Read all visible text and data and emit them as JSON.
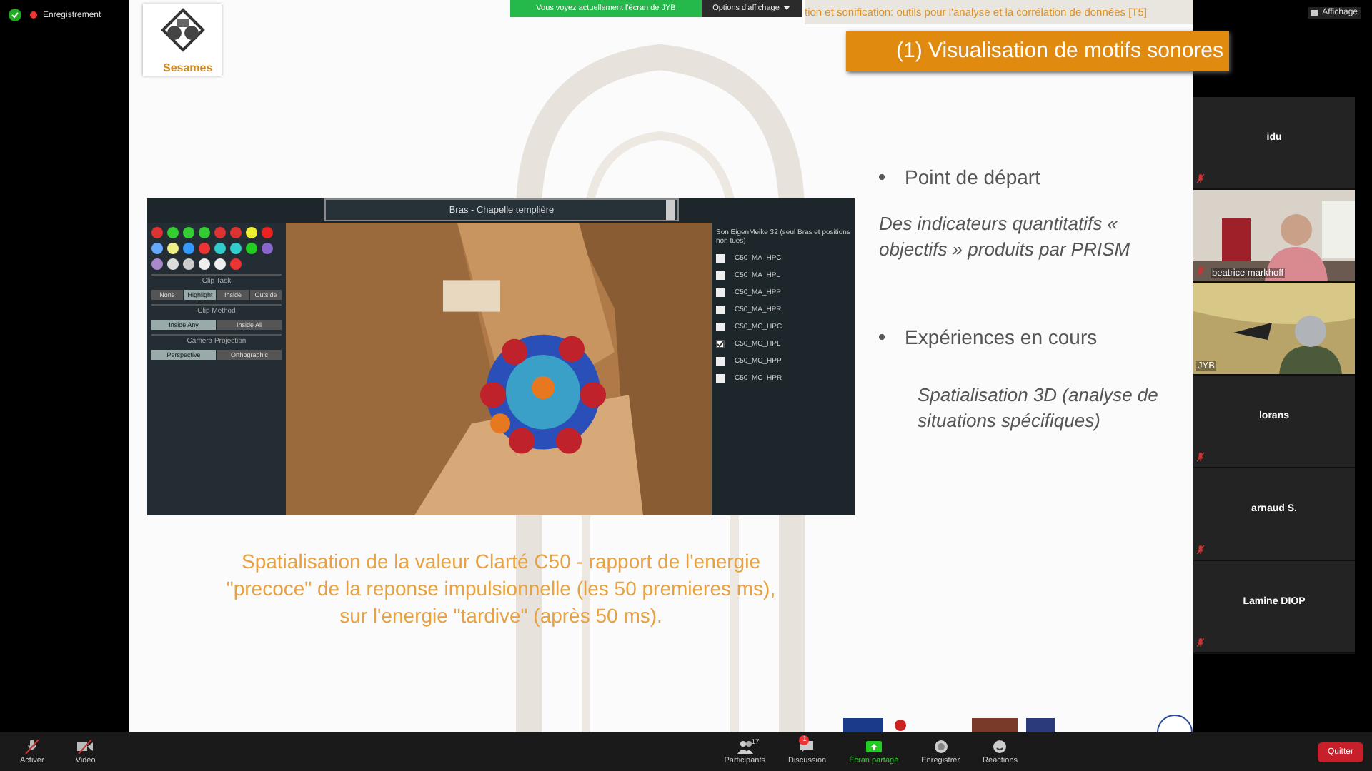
{
  "top_bar": {
    "recording": "Enregistrement",
    "view_button": "Affichage"
  },
  "share_banner": {
    "text": "Vous voyez actuellement l'écran de JYB",
    "options": "Options d'affichage"
  },
  "slide": {
    "header": "tion et sonification: outils pour l'analyse et la corrélation de données [T5]",
    "logo_text": "Sesames",
    "title": "(1) Visualisation de motifs sonores",
    "viewer": {
      "dropdown": "Bras - Chapelle templière",
      "sections": [
        {
          "title": "Clip Task",
          "buttons": [
            {
              "label": "None",
              "selected": false
            },
            {
              "label": "Highlight",
              "selected": true
            },
            {
              "label": "Inside",
              "selected": false
            },
            {
              "label": "Outside",
              "selected": false
            }
          ]
        },
        {
          "title": "Clip Method",
          "buttons": [
            {
              "label": "Inside Any",
              "selected": true
            },
            {
              "label": "Inside All",
              "selected": false
            }
          ]
        },
        {
          "title": "Camera Projection",
          "buttons": [
            {
              "label": "Perspective",
              "selected": true
            },
            {
              "label": "Orthographic",
              "selected": false
            }
          ]
        }
      ],
      "list_title": "Son EigenMeike 32 (seul Bras et positions non tues)",
      "options": [
        {
          "label": "C50_MA_HPC",
          "checked": false
        },
        {
          "label": "C50_MA_HPL",
          "checked": false
        },
        {
          "label": "C50_MA_HPP",
          "checked": false
        },
        {
          "label": "C50_MA_HPR",
          "checked": false
        },
        {
          "label": "C50_MC_HPC",
          "checked": false
        },
        {
          "label": "C50_MC_HPL",
          "checked": true
        },
        {
          "label": "C50_MC_HPP",
          "checked": false
        },
        {
          "label": "C50_MC_HPR",
          "checked": false
        }
      ]
    },
    "caption": "Spatialisation de la valeur Clarté C50 - rapport de l'energie \"precoce\" de la reponse impulsionnelle (les 50 premieres ms), sur l'energie \"tardive\" (après 50 ms).",
    "points": [
      {
        "kind": "bullet",
        "text": "Point de départ"
      },
      {
        "kind": "note",
        "text": "Des indicateurs quantitatifs « objectifs » produits par PRISM"
      },
      {
        "kind": "bullet",
        "text": "Expériences en cours"
      },
      {
        "kind": "subnote",
        "text": "Spatialisation 3D (analyse de situations spécifiques)"
      }
    ]
  },
  "participants": [
    {
      "name": "idu",
      "kind": "avatar",
      "muted": true
    },
    {
      "name": "beatrice markhoff",
      "kind": "video",
      "muted": true
    },
    {
      "name": "JYB",
      "kind": "video",
      "muted": false
    },
    {
      "name": "lorans",
      "kind": "avatar",
      "muted": true
    },
    {
      "name": "arnaud S.",
      "kind": "avatar",
      "muted": true
    },
    {
      "name": "Lamine DIOP",
      "kind": "avatar",
      "muted": true
    }
  ],
  "toolbar": {
    "left": [
      {
        "kind": "mic",
        "label": "Activer",
        "off": true
      },
      {
        "kind": "camera",
        "label": "Vidéo",
        "off": true
      }
    ],
    "center": [
      {
        "kind": "people",
        "label": "Participants",
        "count": "17",
        "active": false
      },
      {
        "kind": "chat",
        "label": "Discussion",
        "badge": "1",
        "active": false
      },
      {
        "kind": "share",
        "label": "Écran partagé",
        "active": true
      },
      {
        "kind": "record",
        "label": "Enregistrer",
        "active": false
      },
      {
        "kind": "smile",
        "label": "Réactions",
        "active": false
      }
    ],
    "quit": "Quitter"
  }
}
